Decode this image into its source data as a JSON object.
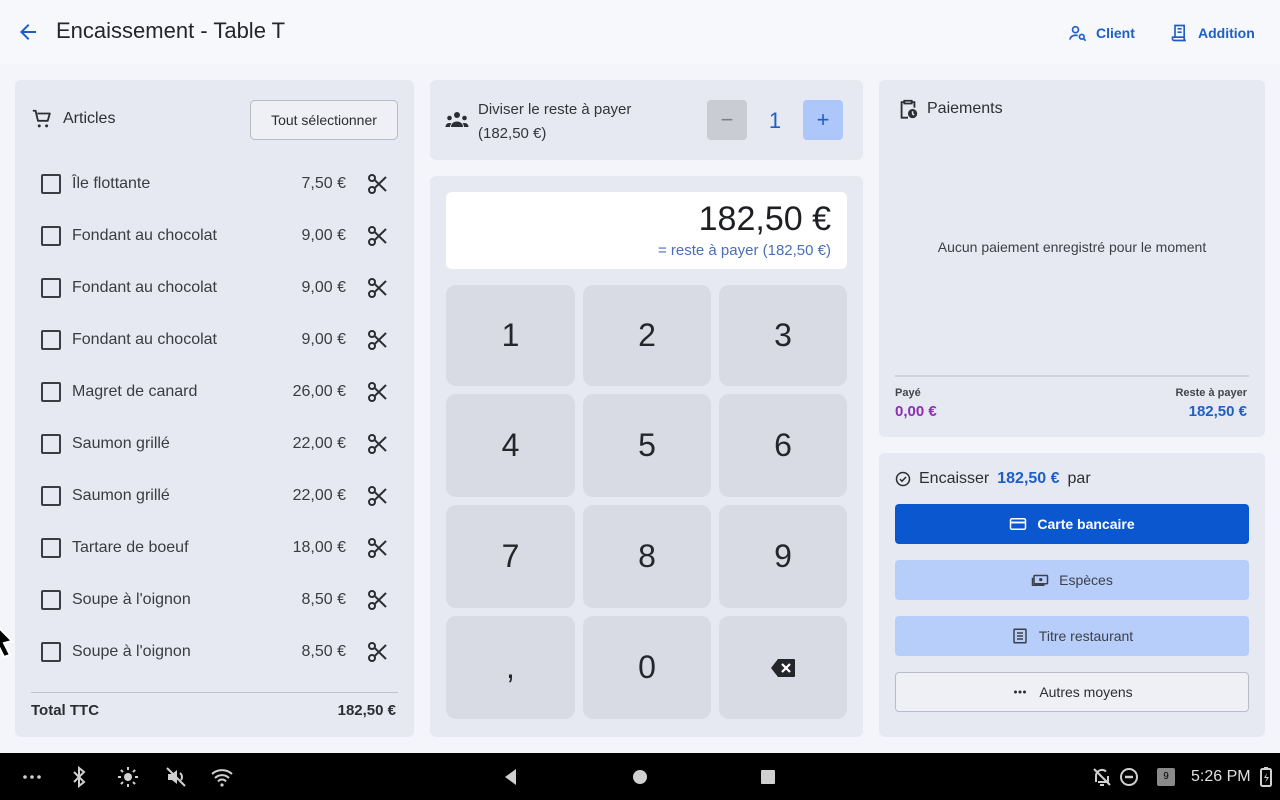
{
  "header": {
    "title": "Encaissement - Table T",
    "client_label": "Client",
    "addition_label": "Addition"
  },
  "articles": {
    "title": "Articles",
    "select_all_label": "Tout sélectionner",
    "items": [
      {
        "name": "Île flottante",
        "price": "7,50 €"
      },
      {
        "name": "Fondant au chocolat",
        "price": "9,00 €"
      },
      {
        "name": "Fondant au chocolat",
        "price": "9,00 €"
      },
      {
        "name": "Fondant au chocolat",
        "price": "9,00 €"
      },
      {
        "name": "Magret de canard",
        "price": "26,00 €"
      },
      {
        "name": "Saumon grillé",
        "price": "22,00 €"
      },
      {
        "name": "Saumon grillé",
        "price": "22,00 €"
      },
      {
        "name": "Tartare de boeuf",
        "price": "18,00 €"
      },
      {
        "name": "Soupe à l'oignon",
        "price": "8,50 €"
      },
      {
        "name": "Soupe à l'oignon",
        "price": "8,50 €"
      }
    ],
    "total_label": "Total TTC",
    "total_value": "182,50 €"
  },
  "split": {
    "line1": "Diviser le reste à payer",
    "line2": "(182,50 €)",
    "minus": "−",
    "count": "1",
    "plus": "+"
  },
  "keypad": {
    "amount": "182,50 €",
    "amount_sub": "= reste à payer (182,50 €)",
    "keys": [
      "1",
      "2",
      "3",
      "4",
      "5",
      "6",
      "7",
      "8",
      "9",
      ",",
      "0"
    ]
  },
  "payments": {
    "title": "Paiements",
    "empty_text": "Aucun paiement enregistré pour le moment",
    "paid_label": "Payé",
    "paid_value": "0,00 €",
    "rest_label": "Reste à payer",
    "rest_value": "182,50 €",
    "paid_color": "#8a2fb0"
  },
  "encaisser": {
    "prefix": "Encaisser",
    "amount": "182,50 €",
    "suffix": "par",
    "card_label": "Carte bancaire",
    "cash_label": "Espèces",
    "ticket_label": "Titre restaurant",
    "other_label": "Autres moyens"
  },
  "system_bar": {
    "time": "5:26 PM",
    "notif_count": "9"
  },
  "colors": {
    "accent": "#1e5fc7",
    "primary_button": "#0b57d0",
    "tonal_button": "#b7cdfa"
  }
}
